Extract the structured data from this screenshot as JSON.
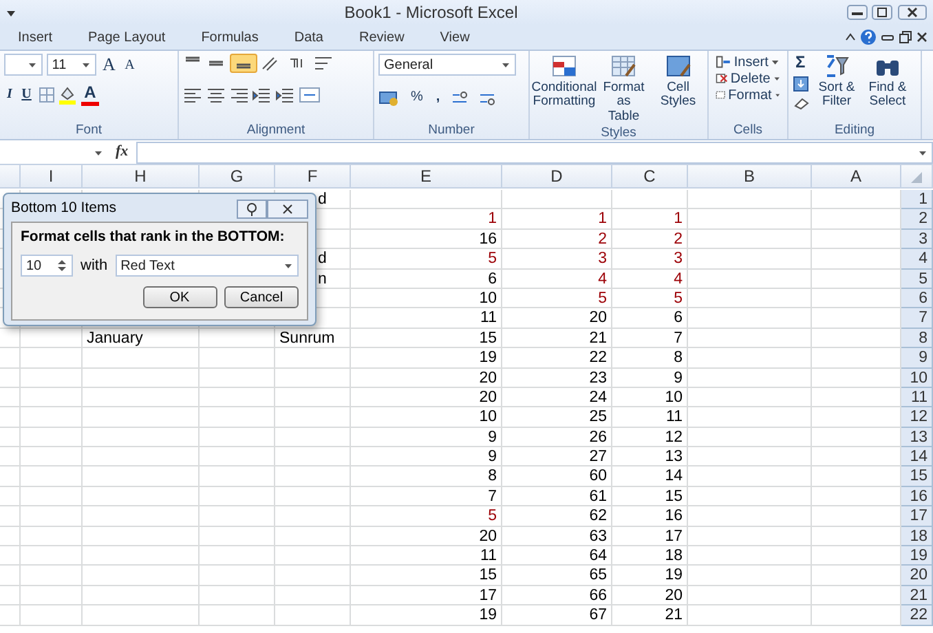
{
  "window": {
    "title": "Book1  -  Microsoft Excel"
  },
  "ribbon_tabs": [
    {
      "label": "Insert",
      "selected": false
    },
    {
      "label": "Page Layout",
      "selected": false
    },
    {
      "label": "Formulas",
      "selected": false
    },
    {
      "label": "Data",
      "selected": false
    },
    {
      "label": "Review",
      "selected": false
    },
    {
      "label": "View",
      "selected": false
    }
  ],
  "ribbon": {
    "font": {
      "size": "11",
      "grow": "A",
      "shrink": "A",
      "italic": "I",
      "underline": "U",
      "color_letter": "A",
      "label": "Font"
    },
    "alignment": {
      "bottom_align_on": true,
      "label": "Alignment"
    },
    "number": {
      "format": "General",
      "percent": "%",
      "comma": ",",
      "label": "Number"
    },
    "styles": {
      "buttons": [
        "Conditional Formatting",
        "Format as Table",
        "Cell Styles"
      ],
      "label": "Styles"
    },
    "cells": {
      "buttons": [
        "Insert",
        "Delete",
        "Format"
      ],
      "label": "Cells"
    },
    "editing": {
      "sum": "Σ",
      "buttons": [
        "Sort & Filter",
        "Find & Select"
      ],
      "label": "Editing"
    }
  },
  "formula_bar": {
    "function_label": "fx"
  },
  "sheet": {
    "columns": [
      "I",
      "H",
      "G",
      "F",
      "E",
      "D",
      "C",
      "B",
      "A"
    ],
    "rows": [
      {
        "number": "1",
        "cells": [
          null,
          null,
          null,
          {
            "text": "d",
            "kind": "fragment",
            "highlighted": false
          },
          null,
          null,
          null,
          null,
          null
        ]
      },
      {
        "number": "2",
        "cells": [
          null,
          null,
          null,
          null,
          {
            "text": "1",
            "kind": "number",
            "highlighted": true
          },
          {
            "text": "1",
            "kind": "number",
            "highlighted": true
          },
          {
            "text": "1",
            "kind": "number",
            "highlighted": true
          },
          null,
          null
        ]
      },
      {
        "number": "3",
        "cells": [
          null,
          null,
          null,
          null,
          {
            "text": "16",
            "kind": "number",
            "highlighted": false
          },
          {
            "text": "2",
            "kind": "number",
            "highlighted": true
          },
          {
            "text": "2",
            "kind": "number",
            "highlighted": true
          },
          null,
          null
        ]
      },
      {
        "number": "4",
        "cells": [
          null,
          null,
          null,
          {
            "text": "d",
            "kind": "fragment",
            "highlighted": false
          },
          {
            "text": "5",
            "kind": "number",
            "highlighted": true
          },
          {
            "text": "3",
            "kind": "number",
            "highlighted": true
          },
          {
            "text": "3",
            "kind": "number",
            "highlighted": true
          },
          null,
          null
        ]
      },
      {
        "number": "5",
        "cells": [
          null,
          null,
          null,
          {
            "text": "n",
            "kind": "fragment",
            "highlighted": false
          },
          {
            "text": "6",
            "kind": "number",
            "highlighted": false
          },
          {
            "text": "4",
            "kind": "number",
            "highlighted": true
          },
          {
            "text": "4",
            "kind": "number",
            "highlighted": true
          },
          null,
          null
        ]
      },
      {
        "number": "6",
        "cells": [
          null,
          null,
          null,
          null,
          {
            "text": "10",
            "kind": "number",
            "highlighted": false
          },
          {
            "text": "5",
            "kind": "number",
            "highlighted": true
          },
          {
            "text": "5",
            "kind": "number",
            "highlighted": true
          },
          null,
          null
        ]
      },
      {
        "number": "7",
        "cells": [
          null,
          null,
          null,
          null,
          {
            "text": "11",
            "kind": "number",
            "highlighted": false
          },
          {
            "text": "20",
            "kind": "number",
            "highlighted": false
          },
          {
            "text": "6",
            "kind": "number",
            "highlighted": false
          },
          null,
          null
        ]
      },
      {
        "number": "8",
        "cells": [
          null,
          {
            "text": "January",
            "kind": "text",
            "highlighted": false
          },
          null,
          {
            "text": "Sunrum",
            "kind": "text",
            "highlighted": false
          },
          {
            "text": "15",
            "kind": "number",
            "highlighted": false
          },
          {
            "text": "21",
            "kind": "number",
            "highlighted": false
          },
          {
            "text": "7",
            "kind": "number",
            "highlighted": false
          },
          null,
          null
        ]
      },
      {
        "number": "9",
        "cells": [
          null,
          null,
          null,
          null,
          {
            "text": "19",
            "kind": "number",
            "highlighted": false
          },
          {
            "text": "22",
            "kind": "number",
            "highlighted": false
          },
          {
            "text": "8",
            "kind": "number",
            "highlighted": false
          },
          null,
          null
        ]
      },
      {
        "number": "10",
        "cells": [
          null,
          null,
          null,
          null,
          {
            "text": "20",
            "kind": "number",
            "highlighted": false
          },
          {
            "text": "23",
            "kind": "number",
            "highlighted": false
          },
          {
            "text": "9",
            "kind": "number",
            "highlighted": false
          },
          null,
          null
        ]
      },
      {
        "number": "11",
        "cells": [
          null,
          null,
          null,
          null,
          {
            "text": "20",
            "kind": "number",
            "highlighted": false
          },
          {
            "text": "24",
            "kind": "number",
            "highlighted": false
          },
          {
            "text": "10",
            "kind": "number",
            "highlighted": false
          },
          null,
          null
        ]
      },
      {
        "number": "12",
        "cells": [
          null,
          null,
          null,
          null,
          {
            "text": "10",
            "kind": "number",
            "highlighted": false
          },
          {
            "text": "25",
            "kind": "number",
            "highlighted": false
          },
          {
            "text": "11",
            "kind": "number",
            "highlighted": false
          },
          null,
          null
        ]
      },
      {
        "number": "13",
        "cells": [
          null,
          null,
          null,
          null,
          {
            "text": "9",
            "kind": "number",
            "highlighted": false
          },
          {
            "text": "26",
            "kind": "number",
            "highlighted": false
          },
          {
            "text": "12",
            "kind": "number",
            "highlighted": false
          },
          null,
          null
        ]
      },
      {
        "number": "14",
        "cells": [
          null,
          null,
          null,
          null,
          {
            "text": "9",
            "kind": "number",
            "highlighted": false
          },
          {
            "text": "27",
            "kind": "number",
            "highlighted": false
          },
          {
            "text": "13",
            "kind": "number",
            "highlighted": false
          },
          null,
          null
        ]
      },
      {
        "number": "15",
        "cells": [
          null,
          null,
          null,
          null,
          {
            "text": "8",
            "kind": "number",
            "highlighted": false
          },
          {
            "text": "60",
            "kind": "number",
            "highlighted": false
          },
          {
            "text": "14",
            "kind": "number",
            "highlighted": false
          },
          null,
          null
        ]
      },
      {
        "number": "16",
        "cells": [
          null,
          null,
          null,
          null,
          {
            "text": "7",
            "kind": "number",
            "highlighted": false
          },
          {
            "text": "61",
            "kind": "number",
            "highlighted": false
          },
          {
            "text": "15",
            "kind": "number",
            "highlighted": false
          },
          null,
          null
        ]
      },
      {
        "number": "17",
        "cells": [
          null,
          null,
          null,
          null,
          {
            "text": "5",
            "kind": "number",
            "highlighted": true
          },
          {
            "text": "62",
            "kind": "number",
            "highlighted": false
          },
          {
            "text": "16",
            "kind": "number",
            "highlighted": false
          },
          null,
          null
        ]
      },
      {
        "number": "18",
        "cells": [
          null,
          null,
          null,
          null,
          {
            "text": "20",
            "kind": "number",
            "highlighted": false
          },
          {
            "text": "63",
            "kind": "number",
            "highlighted": false
          },
          {
            "text": "17",
            "kind": "number",
            "highlighted": false
          },
          null,
          null
        ]
      },
      {
        "number": "19",
        "cells": [
          null,
          null,
          null,
          null,
          {
            "text": "11",
            "kind": "number",
            "highlighted": false
          },
          {
            "text": "64",
            "kind": "number",
            "highlighted": false
          },
          {
            "text": "18",
            "kind": "number",
            "highlighted": false
          },
          null,
          null
        ]
      },
      {
        "number": "20",
        "cells": [
          null,
          null,
          null,
          null,
          {
            "text": "15",
            "kind": "number",
            "highlighted": false
          },
          {
            "text": "65",
            "kind": "number",
            "highlighted": false
          },
          {
            "text": "19",
            "kind": "number",
            "highlighted": false
          },
          null,
          null
        ]
      },
      {
        "number": "21",
        "cells": [
          null,
          null,
          null,
          null,
          {
            "text": "17",
            "kind": "number",
            "highlighted": false
          },
          {
            "text": "66",
            "kind": "number",
            "highlighted": false
          },
          {
            "text": "20",
            "kind": "number",
            "highlighted": false
          },
          null,
          null
        ]
      },
      {
        "number": "22",
        "cells": [
          null,
          null,
          null,
          null,
          {
            "text": "19",
            "kind": "number",
            "highlighted": false
          },
          {
            "text": "67",
            "kind": "number",
            "highlighted": false
          },
          {
            "text": "21",
            "kind": "number",
            "highlighted": false
          },
          null,
          null
        ]
      }
    ]
  },
  "dialog": {
    "title": "Bottom 10 Items",
    "prompt": "Format cells that rank in the BOTTOM:",
    "count": "10",
    "with_label": "with",
    "format": "Red Text",
    "buttons": [
      "OK",
      "Cancel"
    ]
  }
}
